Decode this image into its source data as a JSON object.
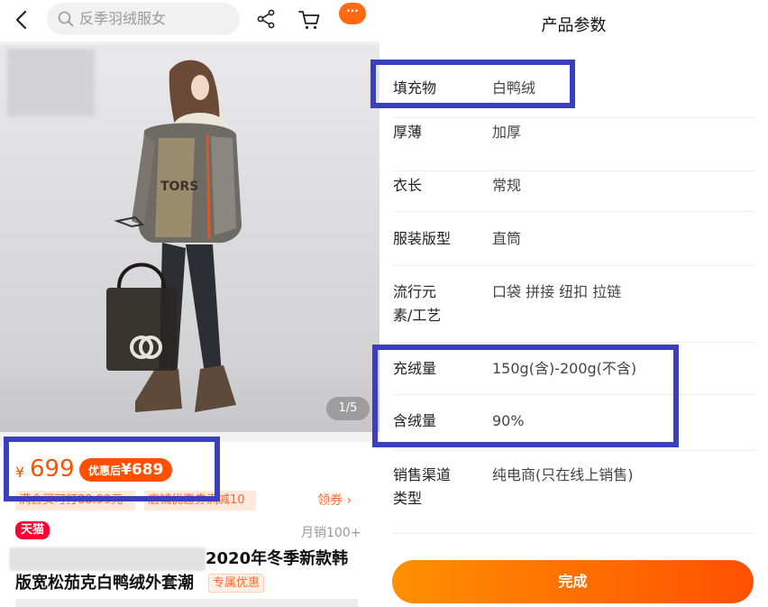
{
  "topbar": {
    "search_placeholder": "反季羽绒服女",
    "more_label": "···"
  },
  "photo": {
    "counter": "1/5"
  },
  "product": {
    "price_symbol": "¥",
    "price": "699",
    "after_discount_label": "优惠后",
    "after_discount_price": "¥689",
    "coupon_1": "满合买可打88.99元",
    "coupon_2": "店铺优惠券满减10",
    "get_coupon": "领券 ›",
    "store_badge": "天猫",
    "monthly_sales": "月销100+",
    "title_line1": "2020年冬季新款韩",
    "title_line2": "版宽松茄克白鸭绒外套潮",
    "exclusive_tag": "专属优惠"
  },
  "params": {
    "title": "产品参数",
    "rows": [
      {
        "key": "填充物",
        "value": "白鸭绒"
      },
      {
        "key": "厚薄",
        "value": "加厚"
      },
      {
        "key": "衣长",
        "value": "常规"
      },
      {
        "key": "服装版型",
        "value": "直筒"
      },
      {
        "key": "流行元素/工艺",
        "value": "口袋 拼接 纽扣 拉链"
      },
      {
        "key": "充绒量",
        "value": "150g(含)-200g(不含)"
      },
      {
        "key": "含绒量",
        "value": "90%"
      },
      {
        "key": "销售渠道类型",
        "value": "纯电商(只在线上销售)"
      }
    ],
    "done_label": "完成"
  },
  "colors": {
    "accent": "#ff5000",
    "highlight_frame": "#3a3fbe",
    "tmall_red": "#ff0036"
  }
}
